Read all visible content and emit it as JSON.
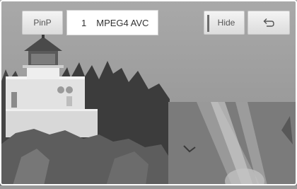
{
  "toolbar": {
    "pinp_label": "PinP",
    "channel_number": "1",
    "channel_name": "MPEG4 AVC",
    "hide_label": "Hide",
    "back_icon": "return-arrow-icon"
  },
  "colors": {
    "button_bg": "#e8e8e8",
    "channel_bg": "#ffffff",
    "text": "#444444"
  }
}
